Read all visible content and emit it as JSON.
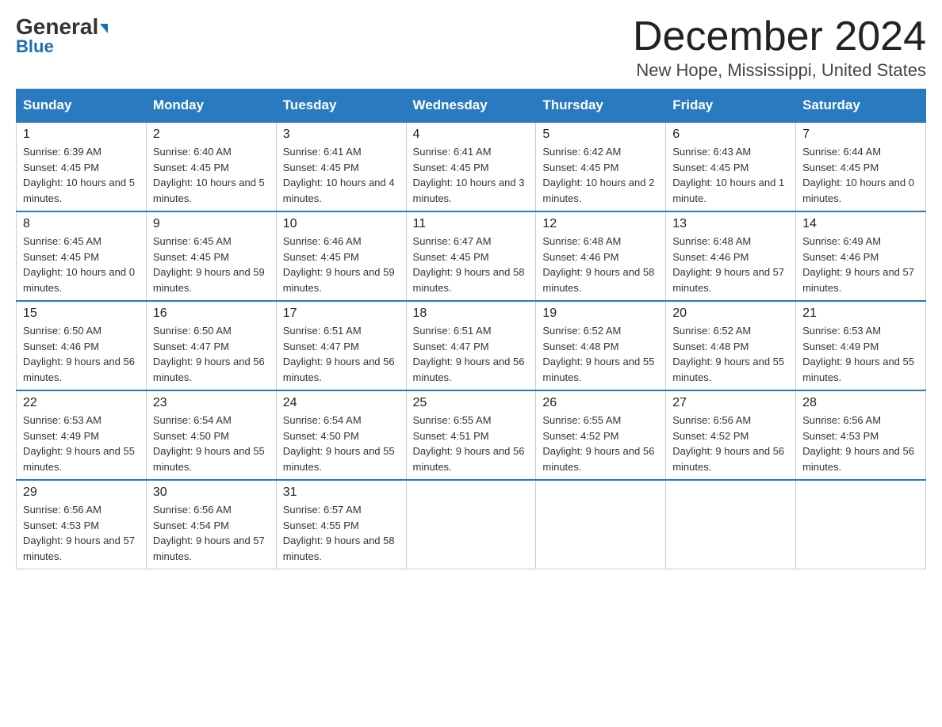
{
  "logo": {
    "part1": "General",
    "part2": "Blue"
  },
  "header": {
    "month_year": "December 2024",
    "location": "New Hope, Mississippi, United States"
  },
  "days_of_week": [
    "Sunday",
    "Monday",
    "Tuesday",
    "Wednesday",
    "Thursday",
    "Friday",
    "Saturday"
  ],
  "weeks": [
    [
      {
        "day": "1",
        "sunrise": "6:39 AM",
        "sunset": "4:45 PM",
        "daylight": "10 hours and 5 minutes."
      },
      {
        "day": "2",
        "sunrise": "6:40 AM",
        "sunset": "4:45 PM",
        "daylight": "10 hours and 5 minutes."
      },
      {
        "day": "3",
        "sunrise": "6:41 AM",
        "sunset": "4:45 PM",
        "daylight": "10 hours and 4 minutes."
      },
      {
        "day": "4",
        "sunrise": "6:41 AM",
        "sunset": "4:45 PM",
        "daylight": "10 hours and 3 minutes."
      },
      {
        "day": "5",
        "sunrise": "6:42 AM",
        "sunset": "4:45 PM",
        "daylight": "10 hours and 2 minutes."
      },
      {
        "day": "6",
        "sunrise": "6:43 AM",
        "sunset": "4:45 PM",
        "daylight": "10 hours and 1 minute."
      },
      {
        "day": "7",
        "sunrise": "6:44 AM",
        "sunset": "4:45 PM",
        "daylight": "10 hours and 0 minutes."
      }
    ],
    [
      {
        "day": "8",
        "sunrise": "6:45 AM",
        "sunset": "4:45 PM",
        "daylight": "10 hours and 0 minutes."
      },
      {
        "day": "9",
        "sunrise": "6:45 AM",
        "sunset": "4:45 PM",
        "daylight": "9 hours and 59 minutes."
      },
      {
        "day": "10",
        "sunrise": "6:46 AM",
        "sunset": "4:45 PM",
        "daylight": "9 hours and 59 minutes."
      },
      {
        "day": "11",
        "sunrise": "6:47 AM",
        "sunset": "4:45 PM",
        "daylight": "9 hours and 58 minutes."
      },
      {
        "day": "12",
        "sunrise": "6:48 AM",
        "sunset": "4:46 PM",
        "daylight": "9 hours and 58 minutes."
      },
      {
        "day": "13",
        "sunrise": "6:48 AM",
        "sunset": "4:46 PM",
        "daylight": "9 hours and 57 minutes."
      },
      {
        "day": "14",
        "sunrise": "6:49 AM",
        "sunset": "4:46 PM",
        "daylight": "9 hours and 57 minutes."
      }
    ],
    [
      {
        "day": "15",
        "sunrise": "6:50 AM",
        "sunset": "4:46 PM",
        "daylight": "9 hours and 56 minutes."
      },
      {
        "day": "16",
        "sunrise": "6:50 AM",
        "sunset": "4:47 PM",
        "daylight": "9 hours and 56 minutes."
      },
      {
        "day": "17",
        "sunrise": "6:51 AM",
        "sunset": "4:47 PM",
        "daylight": "9 hours and 56 minutes."
      },
      {
        "day": "18",
        "sunrise": "6:51 AM",
        "sunset": "4:47 PM",
        "daylight": "9 hours and 56 minutes."
      },
      {
        "day": "19",
        "sunrise": "6:52 AM",
        "sunset": "4:48 PM",
        "daylight": "9 hours and 55 minutes."
      },
      {
        "day": "20",
        "sunrise": "6:52 AM",
        "sunset": "4:48 PM",
        "daylight": "9 hours and 55 minutes."
      },
      {
        "day": "21",
        "sunrise": "6:53 AM",
        "sunset": "4:49 PM",
        "daylight": "9 hours and 55 minutes."
      }
    ],
    [
      {
        "day": "22",
        "sunrise": "6:53 AM",
        "sunset": "4:49 PM",
        "daylight": "9 hours and 55 minutes."
      },
      {
        "day": "23",
        "sunrise": "6:54 AM",
        "sunset": "4:50 PM",
        "daylight": "9 hours and 55 minutes."
      },
      {
        "day": "24",
        "sunrise": "6:54 AM",
        "sunset": "4:50 PM",
        "daylight": "9 hours and 55 minutes."
      },
      {
        "day": "25",
        "sunrise": "6:55 AM",
        "sunset": "4:51 PM",
        "daylight": "9 hours and 56 minutes."
      },
      {
        "day": "26",
        "sunrise": "6:55 AM",
        "sunset": "4:52 PM",
        "daylight": "9 hours and 56 minutes."
      },
      {
        "day": "27",
        "sunrise": "6:56 AM",
        "sunset": "4:52 PM",
        "daylight": "9 hours and 56 minutes."
      },
      {
        "day": "28",
        "sunrise": "6:56 AM",
        "sunset": "4:53 PM",
        "daylight": "9 hours and 56 minutes."
      }
    ],
    [
      {
        "day": "29",
        "sunrise": "6:56 AM",
        "sunset": "4:53 PM",
        "daylight": "9 hours and 57 minutes."
      },
      {
        "day": "30",
        "sunrise": "6:56 AM",
        "sunset": "4:54 PM",
        "daylight": "9 hours and 57 minutes."
      },
      {
        "day": "31",
        "sunrise": "6:57 AM",
        "sunset": "4:55 PM",
        "daylight": "9 hours and 58 minutes."
      },
      null,
      null,
      null,
      null
    ]
  ]
}
